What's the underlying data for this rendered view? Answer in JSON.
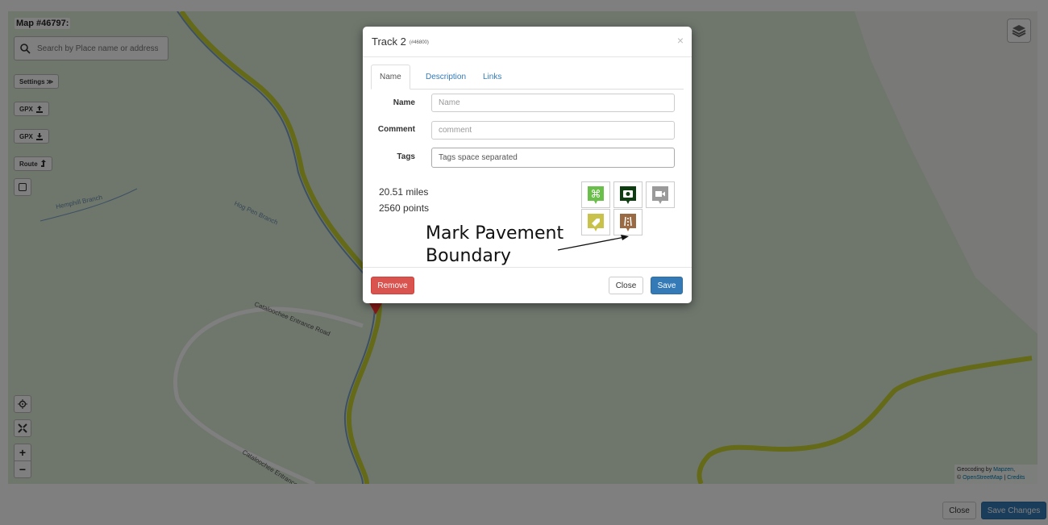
{
  "map": {
    "title": "Map #46797:",
    "search_placeholder": "Search by Place name or address",
    "buttons": {
      "settings": "Settings ≫",
      "gpx_upload": "GPX",
      "gpx_download": "GPX",
      "route": "Route"
    },
    "zoom_in": "+",
    "zoom_out": "−",
    "road_labels": [
      "Cataloochee Entrance Road",
      "Cataloochee Entrance",
      "Hemphill Branch",
      "Hog Pen Branch",
      "Cataloochee Entrance Road"
    ],
    "attribution": {
      "line1_prefix": "Geocoding by ",
      "line1_link": "Mapzen",
      "line1_suffix": ",",
      "line2_prefix": "© ",
      "line2_link": "OpenStreetMap",
      "separator": " | ",
      "credits": "Credits"
    }
  },
  "modal": {
    "title": "Track 2",
    "id": "(#46800)",
    "close_symbol": "×",
    "tabs": [
      "Name",
      "Description",
      "Links"
    ],
    "active_tab": "Name",
    "fields": {
      "name": {
        "label": "Name",
        "placeholder": "Name"
      },
      "comment": {
        "label": "Comment",
        "placeholder": "comment"
      },
      "tags": {
        "label": "Tags",
        "placeholder": "Tags space separated"
      }
    },
    "stats": {
      "distance": "20.51 miles",
      "points": "2560 points"
    },
    "marker_icons": [
      "command-marker-icon",
      "camera-marker-icon",
      "video-marker-icon",
      "tag-marker-icon",
      "pavement-boundary-marker-icon"
    ],
    "buttons": {
      "remove": "Remove",
      "close": "Close",
      "save": "Save"
    }
  },
  "annotation": {
    "line1": "Mark Pavement",
    "line2": "Boundary"
  },
  "footer": {
    "close": "Close",
    "save_changes": "Save Changes"
  },
  "colors": {
    "primary": "#337ab7",
    "danger": "#d9534f",
    "track": "#c9d431",
    "map_bg": "#dfeeda"
  }
}
